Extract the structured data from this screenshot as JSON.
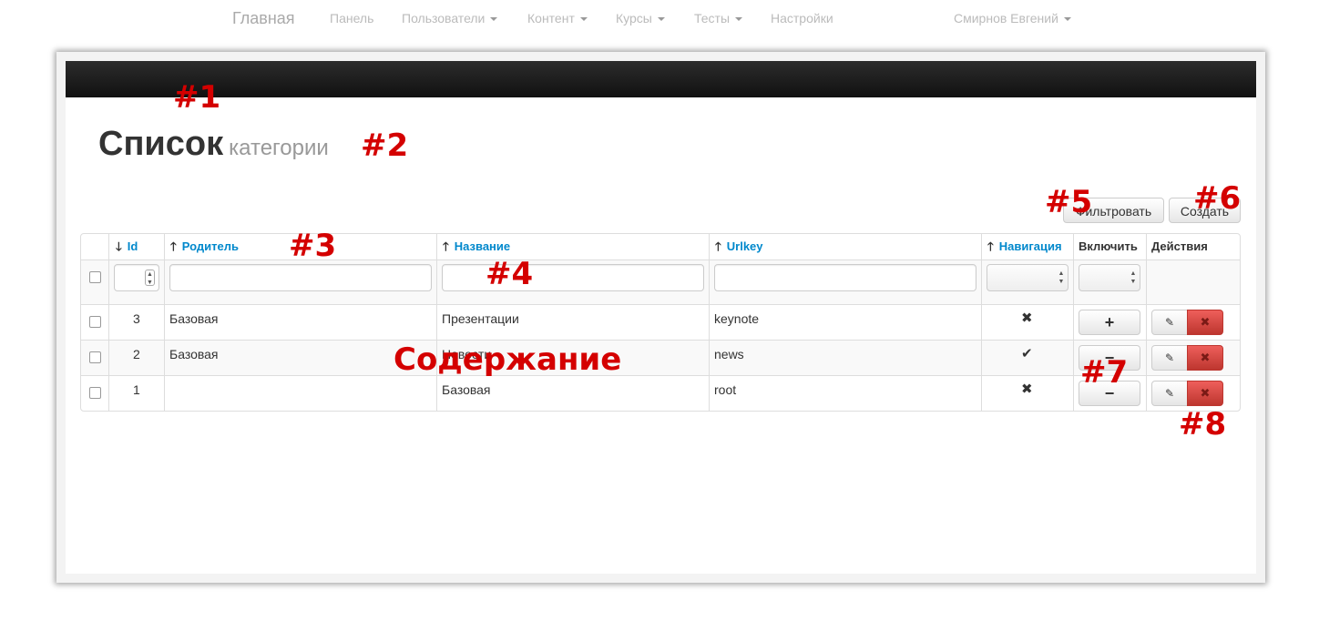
{
  "navbar": {
    "brand": "Главная",
    "items": [
      {
        "label": "Панель"
      },
      {
        "label": "Пользователи"
      },
      {
        "label": "Контент"
      },
      {
        "label": "Курсы"
      },
      {
        "label": "Тесты"
      },
      {
        "label": "Настройки"
      }
    ],
    "user": "Смирнов Евгений"
  },
  "page": {
    "title": "Список",
    "subtitle": "категории"
  },
  "toolbar": {
    "filter_label": "Фильтровать",
    "create_label": "Создать"
  },
  "table": {
    "columns": [
      {
        "label": "Id",
        "sort": "down",
        "sortable": true
      },
      {
        "label": "Родитель",
        "sort": "up",
        "sortable": true
      },
      {
        "label": "Название",
        "sort": "up",
        "sortable": true
      },
      {
        "label": "Urlkey",
        "sort": "up",
        "sortable": true
      },
      {
        "label": "Навигация",
        "sort": "up",
        "sortable": true
      },
      {
        "label": "Включить",
        "sortable": false
      },
      {
        "label": "Действия",
        "sortable": false
      }
    ],
    "rows": [
      {
        "id": "3",
        "parent": "Базовая",
        "name": "Презентации",
        "urlkey": "keynote",
        "nav": "✖",
        "toggle": "+"
      },
      {
        "id": "2",
        "parent": "Базовая",
        "name": "Новости",
        "urlkey": "news",
        "nav": "✔",
        "toggle": "−"
      },
      {
        "id": "1",
        "parent": "",
        "name": "Базовая",
        "urlkey": "root",
        "nav": "✖",
        "toggle": "−"
      }
    ],
    "edit_icon": "edit-icon",
    "delete_icon": "delete-icon"
  },
  "annotations": {
    "a1": "#1",
    "a2": "#2",
    "a3": "#3",
    "a4": "#4",
    "a5": "#5",
    "a6": "#6",
    "a7": "#7",
    "a8": "#8",
    "content": "Содержание"
  },
  "colors": {
    "navbar": "#1b1b1b",
    "link": "#0088cc",
    "danger": "#da4f49",
    "annotation": "#d40000"
  }
}
